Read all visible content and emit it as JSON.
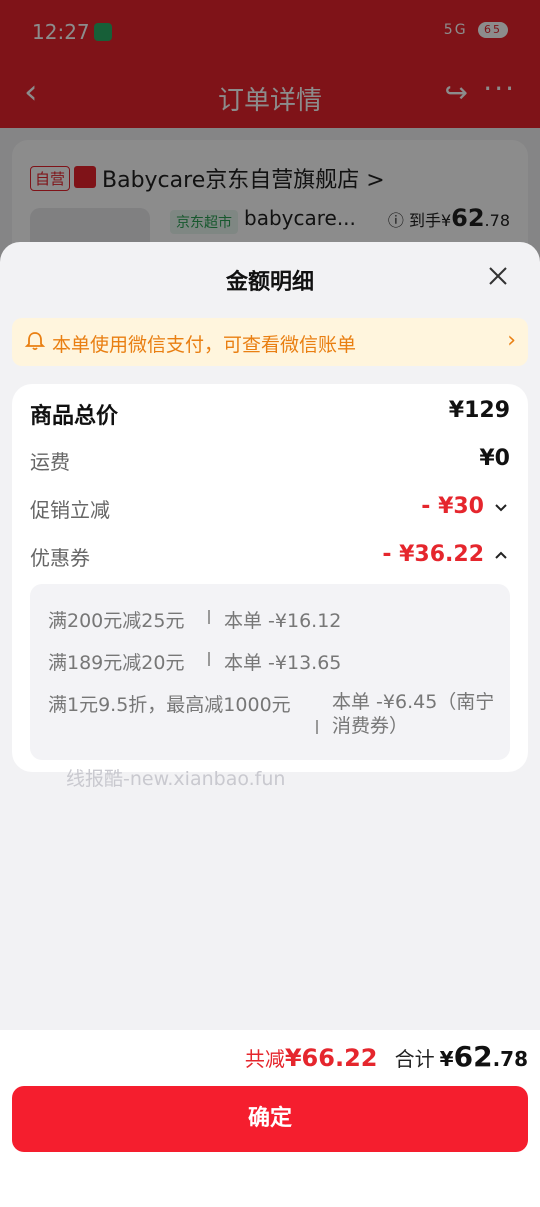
{
  "status_bar": {
    "time": "12:27",
    "battery": "65",
    "network": "5G"
  },
  "nav": {
    "title": "订单详情"
  },
  "store": {
    "self_badge": "自营",
    "name": "Babycare京东自营旗舰店 >",
    "market_tag": "京东超市",
    "product_name": "babycare...",
    "price_prefix": "到手",
    "price_symbol": "¥",
    "price_int": "62",
    "price_dec": ".78"
  },
  "sheet": {
    "title": "金额明细",
    "notice": "本单使用微信支付，可查看微信账单",
    "rows": {
      "total_label": "商品总价",
      "total_value": "¥129",
      "shipping_label": "运费",
      "shipping_value": "¥0",
      "promo_label": "促销立减",
      "promo_value": "- ¥30",
      "coupon_label": "优惠券",
      "coupon_value": "- ¥36.22"
    },
    "coupons": [
      {
        "condition": "满200元减25元",
        "amount": "本单 -¥16.12"
      },
      {
        "condition": "满189元减20元",
        "amount": "本单 -¥13.65"
      },
      {
        "condition": "满1元9.5折，最高减1000元",
        "amount": "本单 -¥6.45（南宁消费券）"
      }
    ],
    "watermark": "线报酷-new.xianbao.fun"
  },
  "footer": {
    "saved_label": "共减",
    "saved_value": "¥66.22",
    "sum_label": "合计",
    "sum_symbol": "¥",
    "sum_int": "62",
    "sum_dec": ".78",
    "confirm_label": "确定"
  },
  "colors": {
    "brand_red": "#e8242d",
    "discount_red": "#e5262d",
    "notice_orange": "#e97f12",
    "wechat_green": "#2aae67"
  }
}
